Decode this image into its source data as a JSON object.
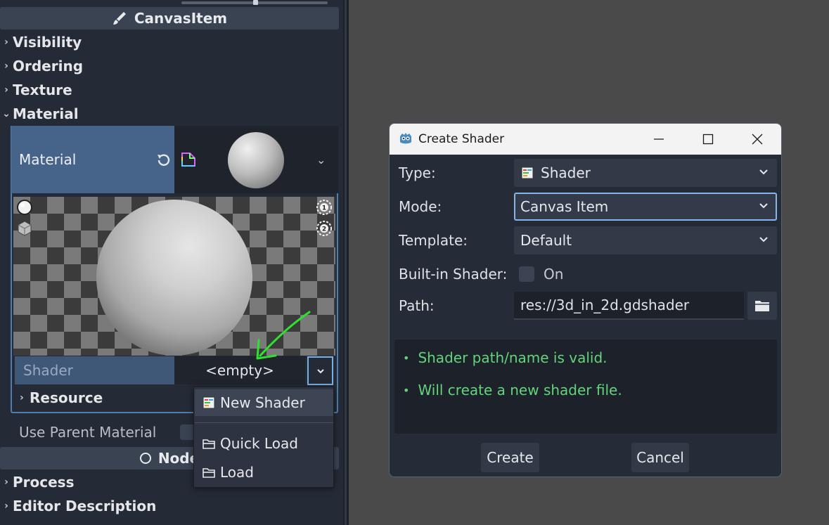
{
  "inspector": {
    "canvas_item_header": "CanvasItem",
    "sections": {
      "visibility": "Visibility",
      "ordering": "Ordering",
      "texture": "Texture",
      "material": "Material"
    },
    "material_property": {
      "label": "Material",
      "expanded": true
    },
    "preview_buttons": {
      "sphere_mode": "sphere-preview",
      "box_mode": "box-preview",
      "light1": "1",
      "light2": "2"
    },
    "shader_property": {
      "label": "Shader",
      "value": "<empty>"
    },
    "resource_section": "Resource",
    "use_parent_material": {
      "label": "Use Parent Material",
      "checked": false
    },
    "node_header": "Node",
    "bottom_sections": {
      "process": "Process",
      "editor_description": "Editor Description"
    }
  },
  "popup_menu": {
    "items": [
      {
        "label": "New Shader",
        "icon": "shader-file-icon",
        "highlighted": true
      },
      {
        "label": "Quick Load",
        "icon": "folder-icon",
        "highlighted": false
      },
      {
        "label": "Load",
        "icon": "folder-icon",
        "highlighted": false
      }
    ]
  },
  "dialog": {
    "title": "Create Shader",
    "fields": {
      "type": {
        "label": "Type:",
        "value": "Shader"
      },
      "mode": {
        "label": "Mode:",
        "value": "Canvas Item"
      },
      "template": {
        "label": "Template:",
        "value": "Default"
      },
      "builtin": {
        "label": "Built-in Shader:",
        "toggle_label": "On",
        "checked": false
      },
      "path": {
        "label": "Path:",
        "value": "res://3d_in_2d.gdshader"
      }
    },
    "messages": [
      "Shader path/name is valid.",
      "Will create a new shader file."
    ],
    "buttons": {
      "create": "Create",
      "cancel": "Cancel"
    },
    "colors": {
      "valid_message": "#63d47a",
      "focus_border": "#84b6ea"
    }
  }
}
